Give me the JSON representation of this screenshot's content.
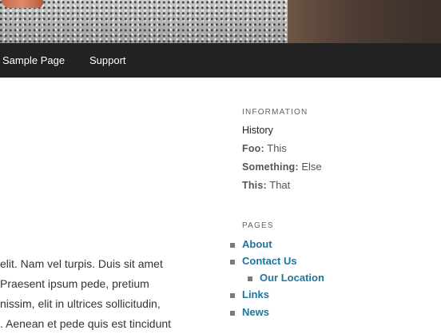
{
  "nav": {
    "items": [
      "Sample Page",
      "Support"
    ]
  },
  "content": {
    "lines": [
      "elit. Nam vel turpis. Duis sit amet",
      "Praesent ipsum pede, pretium",
      "nissim, elit in ultrices sollicitudin,",
      ". Aenean et pede quis est tincidunt"
    ]
  },
  "sidebar": {
    "information": {
      "title": "INFORMATION",
      "history": "History",
      "rows": [
        {
          "key": "Foo:",
          "value": "This"
        },
        {
          "key": "Something:",
          "value": "Else"
        },
        {
          "key": "This:",
          "value": "That"
        }
      ]
    },
    "pages": {
      "title": "PAGES",
      "items": [
        "About",
        "Contact Us",
        "Our Location",
        "Links",
        "News"
      ]
    }
  },
  "colors": {
    "nav_bg": "#222222",
    "link": "#21759b"
  }
}
